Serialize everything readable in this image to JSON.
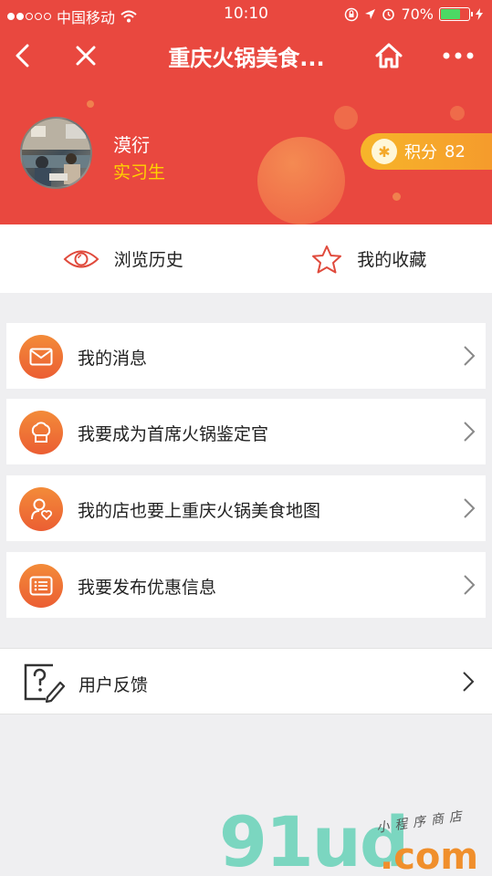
{
  "status_bar": {
    "carrier": "中国移动",
    "time": "10:10",
    "battery": "70%"
  },
  "nav": {
    "title": "重庆火锅美食..."
  },
  "profile": {
    "name": "漠衍",
    "role": "实习生",
    "points_label": "积分",
    "points_value": "82"
  },
  "quick_links": [
    {
      "label": "浏览历史",
      "icon": "eye-icon"
    },
    {
      "label": "我的收藏",
      "icon": "star-icon"
    }
  ],
  "menu": [
    {
      "label": "我的消息",
      "icon": "envelope-icon"
    },
    {
      "label": "我要成为首席火锅鉴定官",
      "icon": "chef-hat-icon"
    },
    {
      "label": "我的店也要上重庆火锅美食地图",
      "icon": "location-heart-icon"
    },
    {
      "label": "我要发布优惠信息",
      "icon": "list-card-icon"
    }
  ],
  "feedback": {
    "label": "用户反馈",
    "icon": "question-edit-icon"
  },
  "watermark": {
    "main": "91ud",
    "com": ".com",
    "sub": "小程序商店"
  },
  "colors": {
    "header_bg": "#e9483f",
    "accent_orange": "#f38b39",
    "points_bg": "#f7b52a",
    "role_yellow": "#ffd200"
  }
}
